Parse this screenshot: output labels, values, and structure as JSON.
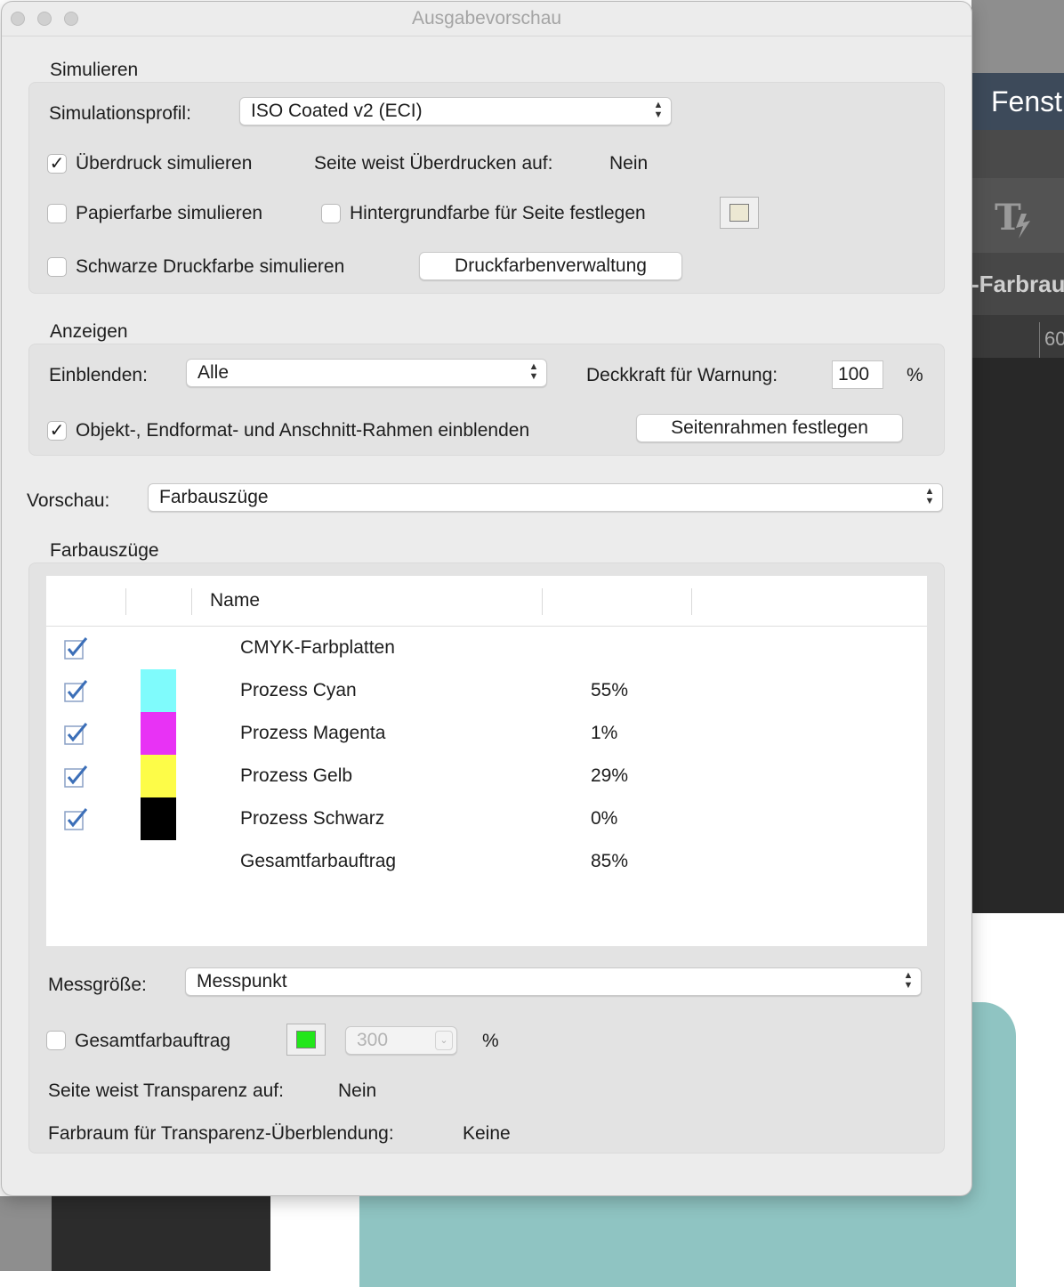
{
  "window": {
    "title": "Ausgabevorschau"
  },
  "background_app": {
    "menu_text": "Fenst",
    "panel_text": "-Farbrau",
    "ruler_text": "60"
  },
  "simulieren": {
    "section_title": "Simulieren",
    "profile_label": "Simulationsprofil:",
    "profile_value": "ISO Coated v2 (ECI)",
    "overprint_label": "Überdruck simulieren",
    "overprint_checked": true,
    "page_overprint_label": "Seite weist Überdrucken auf:",
    "page_overprint_value": "Nein",
    "paper_color_label": "Papierfarbe simulieren",
    "paper_color_checked": false,
    "bg_color_label": "Hintergrundfarbe für Seite festlegen",
    "bg_color_checked": false,
    "bg_swatch_color": "#ece8d3",
    "black_ink_label": "Schwarze Druckfarbe simulieren",
    "black_ink_checked": false,
    "ink_manager_button": "Druckfarbenverwaltung"
  },
  "anzeigen": {
    "section_title": "Anzeigen",
    "show_label": "Einblenden:",
    "show_value": "Alle",
    "opacity_label": "Deckkraft für Warnung:",
    "opacity_value": "100",
    "opacity_unit": "%",
    "frames_label": "Objekt-, Endformat- und Anschnitt-Rahmen einblenden",
    "frames_checked": true,
    "page_frames_button": "Seitenrahmen festlegen"
  },
  "preview": {
    "label": "Vorschau:",
    "value": "Farbauszüge"
  },
  "separations": {
    "section_title": "Farbauszüge",
    "column_name": "Name",
    "rows": [
      {
        "name": "CMYK-Farbplatten",
        "percent": "",
        "checked": true,
        "color": ""
      },
      {
        "name": "Prozess Cyan",
        "percent": "55%",
        "checked": true,
        "color": "#7ffbfc"
      },
      {
        "name": "Prozess Magenta",
        "percent": "1%",
        "checked": true,
        "color": "#e832f5"
      },
      {
        "name": "Prozess Gelb",
        "percent": "29%",
        "checked": true,
        "color": "#fdfc48"
      },
      {
        "name": "Prozess Schwarz",
        "percent": "0%",
        "checked": true,
        "color": "#000000"
      },
      {
        "name": "Gesamtfarbauftrag",
        "percent": "85%",
        "checked": null,
        "color": ""
      }
    ]
  },
  "footer": {
    "measure_label": "Messgröße:",
    "measure_value": "Messpunkt",
    "total_ink_label": "Gesamtfarbauftrag",
    "total_ink_checked": false,
    "total_ink_swatch": "#22e61a",
    "total_ink_value": "300",
    "total_ink_unit": "%",
    "transparency_label": "Seite weist Transparenz auf:",
    "transparency_value": "Nein",
    "blend_space_label": "Farbraum für Transparenz-Überblendung:",
    "blend_space_value": "Keine"
  }
}
